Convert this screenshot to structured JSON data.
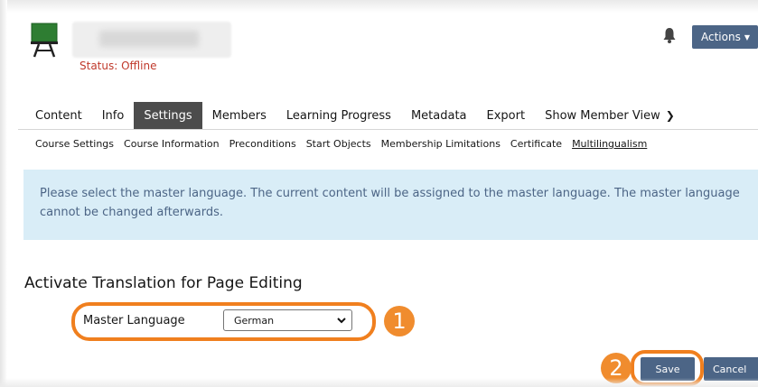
{
  "header": {
    "status": "Status: Offline",
    "actions_label": "Actions"
  },
  "tabs": [
    {
      "label": "Content"
    },
    {
      "label": "Info"
    },
    {
      "label": "Settings",
      "active": true
    },
    {
      "label": "Members"
    },
    {
      "label": "Learning Progress"
    },
    {
      "label": "Metadata"
    },
    {
      "label": "Export"
    },
    {
      "label": "Show Member View"
    }
  ],
  "subtabs": [
    {
      "label": "Course Settings"
    },
    {
      "label": "Course Information"
    },
    {
      "label": "Preconditions"
    },
    {
      "label": "Start Objects"
    },
    {
      "label": "Membership Limitations"
    },
    {
      "label": "Certificate"
    },
    {
      "label": "Multilingualism",
      "active": true
    }
  ],
  "info_message": "Please select the master language. The current content will be assigned to the master language. The master language cannot be changed afterwards.",
  "form": {
    "title": "Activate Translation for Page Editing",
    "master_language_label": "Master Language",
    "master_language_value": "German"
  },
  "buttons": {
    "save": "Save",
    "cancel": "Cancel"
  },
  "callouts": {
    "step1": "1",
    "step2": "2"
  },
  "colors": {
    "accent": "#4c6586",
    "status_offline": "#c0392b",
    "info_bg": "#d9edf7",
    "callout": "#f07f1e"
  },
  "icons": {
    "course": "course-board-icon",
    "notifications": "bell-icon",
    "next": "chevron-right-icon"
  }
}
